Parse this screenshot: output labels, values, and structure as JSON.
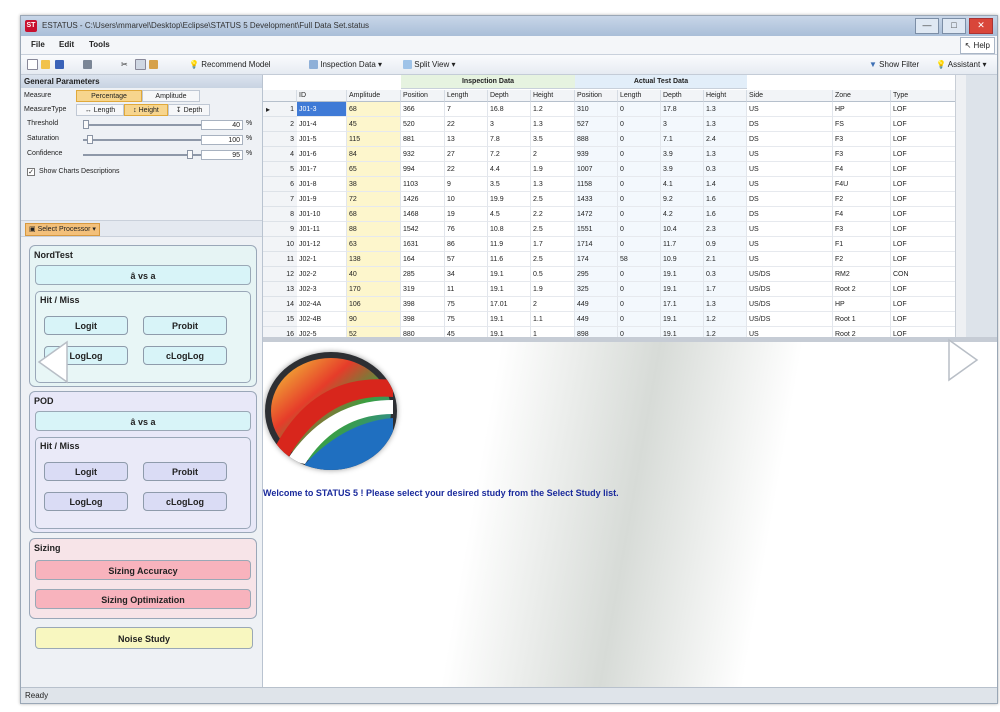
{
  "window": {
    "app_icon": "ST",
    "title": "ESTATUS - C:\\Users\\mmarvel\\Desktop\\Eclipse\\STATUS 5 Development\\Full Data Set.status",
    "buttons": {
      "minimize": "—",
      "maximize": "□",
      "close": "✕"
    }
  },
  "menubar": {
    "file": "File",
    "edit": "Edit",
    "tools": "Tools",
    "help": "Help"
  },
  "toolbar": {
    "recommend_model": "Recommend Model",
    "inspection_data": "Inspection Data",
    "split_view": "Split View",
    "show_filter": "Show Filter",
    "assistant": "Assistant"
  },
  "general_params": {
    "header": "General Parameters",
    "measure_label": "Measure",
    "measure_options": [
      "Percentage",
      "Amplitude"
    ],
    "measure_type_label": "MeasureType",
    "measure_type_options": [
      "Length",
      "Height",
      "Depth"
    ],
    "threshold_label": "Threshold",
    "threshold_value": "40",
    "saturation_label": "Saturation",
    "saturation_value": "100",
    "confidence_label": "Confidence",
    "confidence_value": "95",
    "percent_unit": "%",
    "show_charts_label": "Show Charts Descriptions"
  },
  "select_processor": "Select Processor",
  "ndt": {
    "title": "NordTest",
    "ahat": "â vs a",
    "hitmiss_title": "Hit / Miss",
    "logit": "Logit",
    "probit": "Probit",
    "loglog": "LogLog",
    "cloglog": "cLogLog"
  },
  "pod": {
    "title": "POD",
    "ahat": "â vs a",
    "hitmiss_title": "Hit / Miss",
    "logit": "Logit",
    "probit": "Probit",
    "loglog": "LogLog",
    "cloglog": "cLogLog"
  },
  "sizing": {
    "title": "Sizing",
    "accuracy": "Sizing Accuracy",
    "optimization": "Sizing Optimization"
  },
  "noise_study": "Noise Study",
  "grid": {
    "group_inspection": "Inspection Data",
    "group_actual": "Actual Test Data",
    "columns": [
      "ID",
      "Amplitude",
      "Position",
      "Length",
      "Depth",
      "Height",
      "Position",
      "Length",
      "Depth",
      "Height",
      "Side",
      "Zone",
      "Type"
    ],
    "rows": [
      [
        "1",
        "J01-3",
        "68",
        "366",
        "7",
        "16.8",
        "1.2",
        "310",
        "0",
        "17.8",
        "1.3",
        "US",
        "HP",
        "LOF"
      ],
      [
        "2",
        "J01-4",
        "45",
        "520",
        "22",
        "3",
        "1.3",
        "527",
        "0",
        "3",
        "1.3",
        "DS",
        "FS",
        "LOF"
      ],
      [
        "3",
        "J01-5",
        "115",
        "881",
        "13",
        "7.8",
        "3.5",
        "888",
        "0",
        "7.1",
        "2.4",
        "DS",
        "F3",
        "LOF"
      ],
      [
        "4",
        "J01-6",
        "84",
        "932",
        "27",
        "7.2",
        "2",
        "939",
        "0",
        "3.9",
        "1.3",
        "US",
        "F3",
        "LOF"
      ],
      [
        "5",
        "J01-7",
        "65",
        "994",
        "22",
        "4.4",
        "1.9",
        "1007",
        "0",
        "3.9",
        "0.3",
        "US",
        "F4",
        "LOF"
      ],
      [
        "6",
        "J01-8",
        "38",
        "1103",
        "9",
        "3.5",
        "1.3",
        "1158",
        "0",
        "4.1",
        "1.4",
        "US",
        "F4U",
        "LOF"
      ],
      [
        "7",
        "J01-9",
        "72",
        "1426",
        "10",
        "19.9",
        "2.5",
        "1433",
        "0",
        "9.2",
        "1.6",
        "DS",
        "F2",
        "LOF"
      ],
      [
        "8",
        "J01-10",
        "68",
        "1468",
        "19",
        "4.5",
        "2.2",
        "1472",
        "0",
        "4.2",
        "1.6",
        "DS",
        "F4",
        "LOF"
      ],
      [
        "9",
        "J01-11",
        "88",
        "1542",
        "76",
        "10.8",
        "2.5",
        "1551",
        "0",
        "10.4",
        "2.3",
        "US",
        "F3",
        "LOF"
      ],
      [
        "10",
        "J01-12",
        "63",
        "1631",
        "86",
        "11.9",
        "1.7",
        "1714",
        "0",
        "11.7",
        "0.9",
        "US",
        "F1",
        "LOF"
      ],
      [
        "11",
        "J02-1",
        "138",
        "164",
        "57",
        "11.6",
        "2.5",
        "174",
        "58",
        "10.9",
        "2.1",
        "US",
        "F2",
        "LOF"
      ],
      [
        "12",
        "J02-2",
        "40",
        "285",
        "34",
        "19.1",
        "0.5",
        "295",
        "0",
        "19.1",
        "0.3",
        "US/DS",
        "RM2",
        "CON"
      ],
      [
        "13",
        "J02-3",
        "170",
        "319",
        "11",
        "19.1",
        "1.9",
        "325",
        "0",
        "19.1",
        "1.7",
        "US/DS",
        "Root 2",
        "LOF"
      ],
      [
        "14",
        "J02-4A",
        "106",
        "398",
        "75",
        "17.01",
        "2",
        "449",
        "0",
        "17.1",
        "1.3",
        "US/DS",
        "HP",
        "LOF"
      ],
      [
        "15",
        "J02-4B",
        "90",
        "398",
        "75",
        "19.1",
        "1.1",
        "449",
        "0",
        "19.1",
        "1.2",
        "US/DS",
        "Root 1",
        "LOF"
      ],
      [
        "16",
        "J02-5",
        "52",
        "880",
        "45",
        "19.1",
        "1",
        "898",
        "0",
        "19.1",
        "1.2",
        "US",
        "Root 2",
        "LOF"
      ]
    ]
  },
  "welcome_message": "Welcome to STATUS 5 ! Please select your desired study from the Select Study list.",
  "status_text": "Ready",
  "icons": {
    "new": "new-file-icon",
    "open": "open-folder-icon",
    "save": "save-icon",
    "print": "print-icon",
    "cut": "cut-icon",
    "copy": "copy-icon",
    "paste": "paste-icon",
    "bulb": "lightbulb-icon",
    "filter": "filter-icon",
    "nav_prev": "chevron-left-icon",
    "nav_next": "chevron-right-icon"
  },
  "colors": {
    "accent_orange": "#f7d58d",
    "inspection_header": "#e6f3e0",
    "actual_header": "#e2eef9",
    "amp_column": "#fdf6cc",
    "nordtest_btn": "#d8f4f8",
    "pod_btn": "#dadcf5",
    "sizing_btn": "#f8b3bd",
    "noise_btn": "#f8f7c0",
    "welcome_text": "#1a2a9c"
  }
}
